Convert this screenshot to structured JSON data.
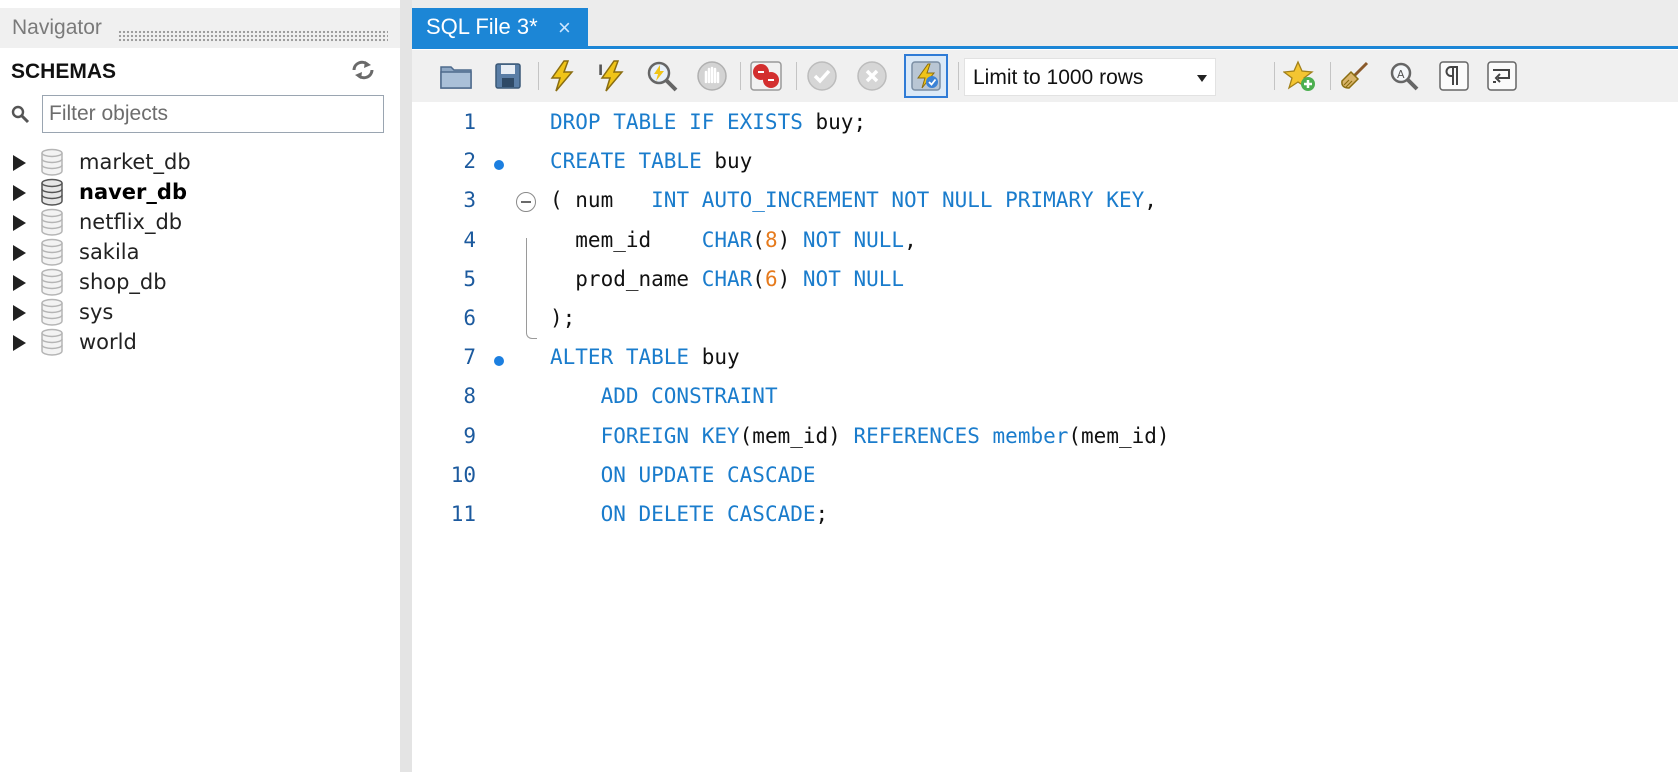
{
  "navigator": {
    "title": "Navigator",
    "schemas_label": "SCHEMAS",
    "filter_placeholder": "Filter objects",
    "schemas": [
      {
        "name": "market_db",
        "active": false
      },
      {
        "name": "naver_db",
        "active": true
      },
      {
        "name": "netflix_db",
        "active": false
      },
      {
        "name": "sakila",
        "active": false
      },
      {
        "name": "shop_db",
        "active": false
      },
      {
        "name": "sys",
        "active": false
      },
      {
        "name": "world",
        "active": false
      }
    ]
  },
  "editor": {
    "tab_label": "SQL File 3*",
    "tab_close": "×",
    "limit_label": "Limit to 1000 rows",
    "lines": [
      {
        "num": "1",
        "dot": false,
        "tokens": [
          [
            "kw",
            "DROP TABLE IF EXISTS"
          ],
          [
            "txt",
            " buy;"
          ]
        ]
      },
      {
        "num": "2",
        "dot": true,
        "tokens": [
          [
            "kw",
            "CREATE TABLE"
          ],
          [
            "txt",
            " buy"
          ]
        ]
      },
      {
        "num": "3",
        "dot": false,
        "tokens": [
          [
            "txt",
            "( num   "
          ],
          [
            "kw",
            "INT AUTO_INCREMENT NOT NULL PRIMARY KEY"
          ],
          [
            "txt",
            ","
          ]
        ]
      },
      {
        "num": "4",
        "dot": false,
        "tokens": [
          [
            "txt",
            "  mem_id    "
          ],
          [
            "kw",
            "CHAR"
          ],
          [
            "txt",
            "("
          ],
          [
            "num",
            "8"
          ],
          [
            "txt",
            ") "
          ],
          [
            "kw",
            "NOT NULL"
          ],
          [
            "txt",
            ","
          ]
        ]
      },
      {
        "num": "5",
        "dot": false,
        "tokens": [
          [
            "txt",
            "  prod_name "
          ],
          [
            "kw",
            "CHAR"
          ],
          [
            "txt",
            "("
          ],
          [
            "num",
            "6"
          ],
          [
            "txt",
            ") "
          ],
          [
            "kw",
            "NOT NULL"
          ]
        ]
      },
      {
        "num": "6",
        "dot": false,
        "tokens": [
          [
            "txt",
            ");"
          ]
        ]
      },
      {
        "num": "7",
        "dot": true,
        "tokens": [
          [
            "kw",
            "ALTER TABLE"
          ],
          [
            "txt",
            " buy"
          ]
        ]
      },
      {
        "num": "8",
        "dot": false,
        "tokens": [
          [
            "txt",
            "    "
          ],
          [
            "kw",
            "ADD CONSTRAINT"
          ]
        ]
      },
      {
        "num": "9",
        "dot": false,
        "tokens": [
          [
            "txt",
            "    "
          ],
          [
            "kw",
            "FOREIGN KEY"
          ],
          [
            "txt",
            "(mem_id) "
          ],
          [
            "kw",
            "REFERENCES member"
          ],
          [
            "txt",
            "(mem_id)"
          ]
        ]
      },
      {
        "num": "10",
        "dot": false,
        "tokens": [
          [
            "txt",
            "    "
          ],
          [
            "kw",
            "ON UPDATE CASCADE"
          ]
        ]
      },
      {
        "num": "11",
        "dot": false,
        "tokens": [
          [
            "txt",
            "    "
          ],
          [
            "kw",
            "ON DELETE CASCADE"
          ],
          [
            "txt",
            ";"
          ]
        ]
      }
    ]
  },
  "colors": {
    "accent": "#1c86d6",
    "keyword": "#1a7ccc",
    "number": "#e67a1c"
  },
  "toolbar_icons": [
    "open-folder-icon",
    "save-icon",
    "execute-icon",
    "execute-current-icon",
    "explain-icon",
    "stop-icon",
    "stop-on-error-icon",
    "commit-icon",
    "rollback-icon",
    "autocommit-toggle-icon",
    "limit-dropdown",
    "add-snippet-icon",
    "beautify-icon",
    "find-icon",
    "invisible-chars-icon",
    "wrap-lines-icon"
  ]
}
